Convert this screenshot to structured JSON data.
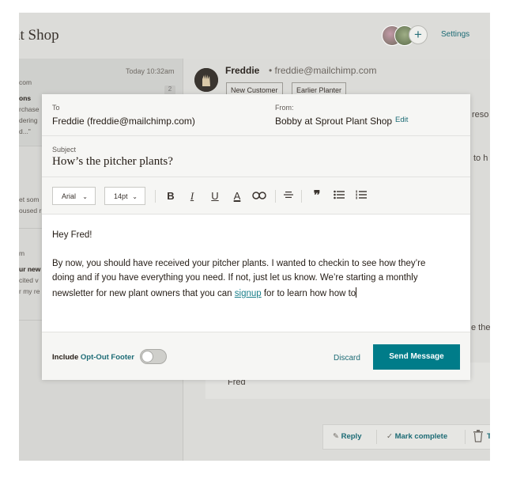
{
  "app": {
    "shop_title": "nt Shop",
    "settings_label": "Settings",
    "add_member": "+"
  },
  "inbox": {
    "time": "Today 10:32am",
    "badge": "2",
    "snippets": [
      "com",
      "ons",
      "rchase",
      "dering",
      "d...\"",
      "et som",
      "oused r",
      "m",
      "ur new",
      "cited v",
      "r my re"
    ]
  },
  "conversation": {
    "name": "Freddie",
    "email": "freddie@mailchimp.com",
    "tags": [
      "New Customer",
      "Earlier Planter"
    ],
    "peek": [
      "reso",
      "to h",
      "e the"
    ],
    "signature": "Fred",
    "actions": {
      "reply": "Reply",
      "mark_complete": "Mark complete",
      "trash_peek": "T"
    }
  },
  "compose": {
    "to_label": "To",
    "to_value": "Freddie (freddie@mailchimp.com)",
    "from_label": "From:",
    "from_value": "Bobby at Sprout Plant Shop",
    "edit_label": "Edit",
    "subject_label": "Subject",
    "subject_value": "How’s the pitcher plants?",
    "toolbar": {
      "font": "Arial",
      "size": "14pt"
    },
    "body": {
      "greeting": "Hey Fred!",
      "line1": "By now, you should have received your pitcher plants. I wanted to checkin to see how they’re",
      "line2": "doing and if you have everything you need. If not, just let us know. We’re starting a monthly",
      "line3_pre": "newsletter for new plant owners that you can ",
      "line3_link": "signup",
      "line3_post": " for to learn how how to"
    },
    "footer": {
      "include_label": "Include ",
      "optout_link": "Opt-Out Footer",
      "discard_label": "Discard",
      "send_label": "Send Message"
    }
  },
  "colors": {
    "accent": "#007c89",
    "link": "#1c6b75"
  }
}
